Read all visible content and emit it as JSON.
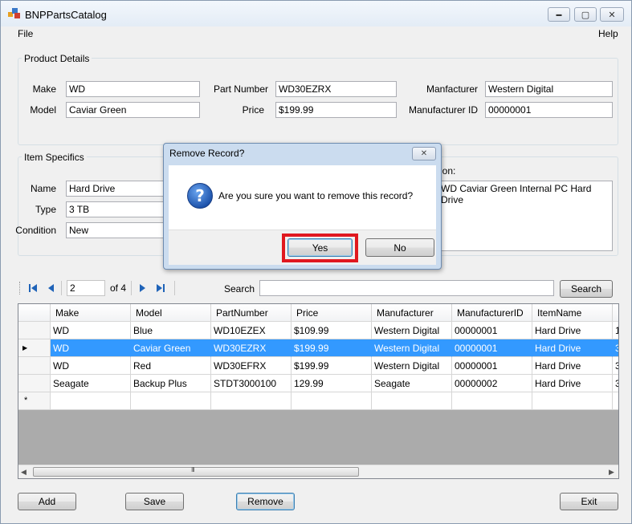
{
  "window": {
    "title": "BNPPartsCatalog",
    "minimize": "▬",
    "maximize": "▢",
    "close": "✕"
  },
  "menu": {
    "file": "File",
    "help": "Help"
  },
  "product_details": {
    "title": "Product Details",
    "make_label": "Make",
    "make": "WD",
    "model_label": "Model",
    "model": "Caviar Green",
    "part_number_label": "Part Number",
    "part_number": "WD30EZRX",
    "price_label": "Price",
    "price": "$199.99",
    "manufacturer_label": "Manfacturer",
    "manufacturer": "Western Digital",
    "manufacturer_id_label": "Manufacturer ID",
    "manufacturer_id": "00000001"
  },
  "item_specifics": {
    "title": "Item Specifics",
    "name_label": "Name",
    "name": "Hard Drive",
    "type_label": "Type",
    "type": "3 TB",
    "condition_label": "Condition",
    "condition": "New",
    "description_label": "ption:",
    "description": "WD Caviar Green Internal PC Hard Drive"
  },
  "navigator": {
    "position": "2",
    "of_label": "of 4",
    "search_label": "Search",
    "search_value": "",
    "search_button": "Search"
  },
  "grid": {
    "columns": [
      "Make",
      "Model",
      "PartNumber",
      "Price",
      "Manufacturer",
      "ManufacturerID",
      "ItemName"
    ],
    "rows": [
      {
        "cells": [
          "WD",
          "Blue",
          "WD10EZEX",
          "$109.99",
          "Western Digital",
          "00000001",
          "Hard Drive"
        ],
        "overflow": "1"
      },
      {
        "cells": [
          "WD",
          "Caviar Green",
          "WD30EZRX",
          "$199.99",
          "Western Digital",
          "00000001",
          "Hard Drive"
        ],
        "overflow": "3"
      },
      {
        "cells": [
          "WD",
          "Red",
          "WD30EFRX",
          "$199.99",
          "Western Digital",
          "00000001",
          "Hard Drive"
        ],
        "overflow": "3"
      },
      {
        "cells": [
          "Seagate",
          "Backup Plus",
          "STDT3000100",
          "129.99",
          "Seagate",
          "00000002",
          "Hard Drive"
        ],
        "overflow": "3"
      }
    ],
    "new_row_marker": "*",
    "scroll_grip": "III"
  },
  "buttons": {
    "add": "Add",
    "save": "Save",
    "remove": "Remove",
    "exit": "Exit"
  },
  "dialog": {
    "title": "Remove Record?",
    "message": "Are you sure you want to remove this record?",
    "icon_glyph": "?",
    "yes": "Yes",
    "no": "No",
    "highlight_color": "#e0181f"
  },
  "colors": {
    "selection": "#3399ff",
    "window_bg": "#f0f0f0"
  }
}
